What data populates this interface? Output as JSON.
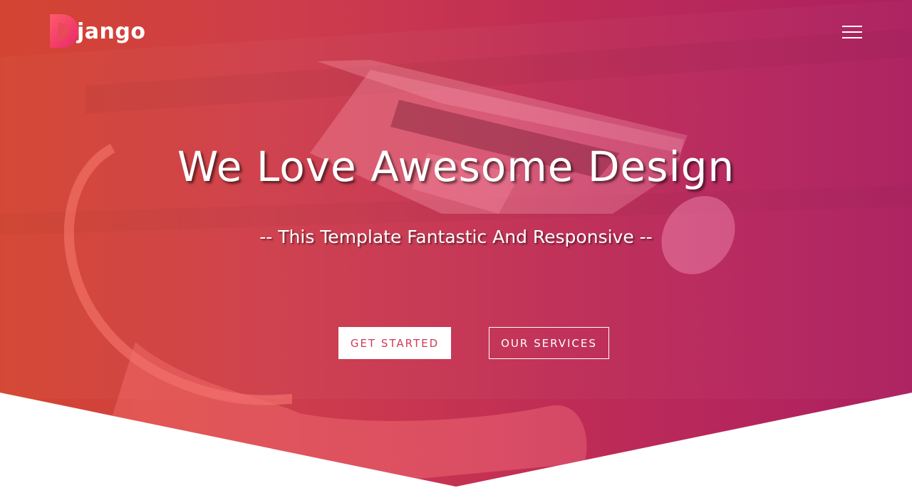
{
  "brand": {
    "name": "jango",
    "mark_letter": "D"
  },
  "hero": {
    "headline": "We Love Awesome Design",
    "subtitle": "-- This Template Fantastic And Responsive --",
    "primary_button": "GET STARTED",
    "secondary_button": "OUR SERVICES"
  },
  "nav": {
    "menu_icon": "hamburger-menu-icon"
  },
  "colors": {
    "gradient_left": "#c8402e",
    "gradient_right": "#a8205e",
    "accent": "#d23a57",
    "logo_mark": "#e8286a",
    "background": "#ffffff"
  }
}
